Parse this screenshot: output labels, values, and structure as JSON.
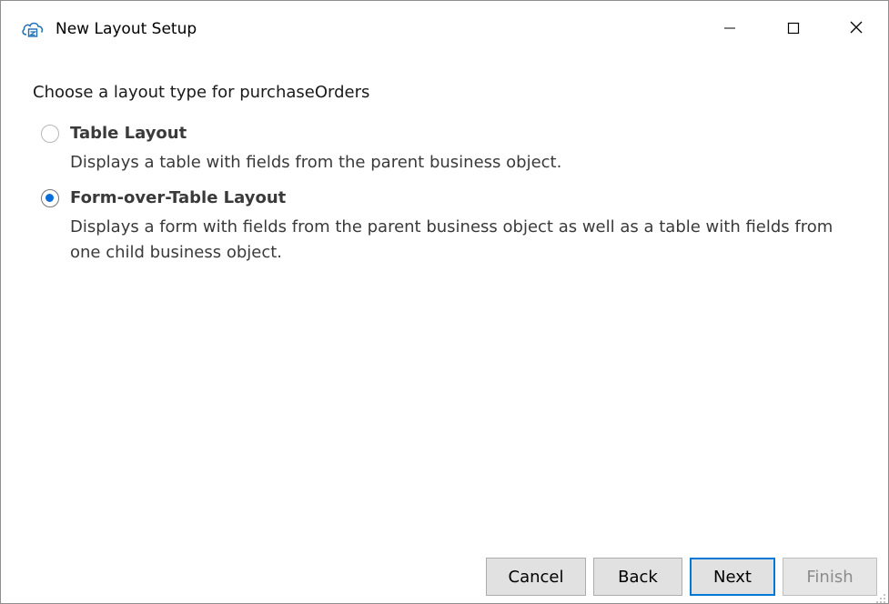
{
  "window": {
    "title": "New Layout Setup",
    "icon": "cloud-app-icon"
  },
  "controls": {
    "minimize_icon": "minimize-icon",
    "maximize_icon": "maximize-icon",
    "close_icon": "close-icon"
  },
  "prompt": "Choose a layout type for purchaseOrders",
  "options": [
    {
      "title": "Table Layout",
      "description": "Displays a table with fields from the parent business object.",
      "selected": false
    },
    {
      "title": "Form-over-Table Layout",
      "description": "Displays a form with fields from the parent business object as well as a table with fields from one child business object.",
      "selected": true
    }
  ],
  "buttons": {
    "cancel": "Cancel",
    "back": "Back",
    "next": "Next",
    "finish": "Finish"
  },
  "colors": {
    "accent": "#0b6ed8",
    "focus_border": "#0078d7"
  }
}
